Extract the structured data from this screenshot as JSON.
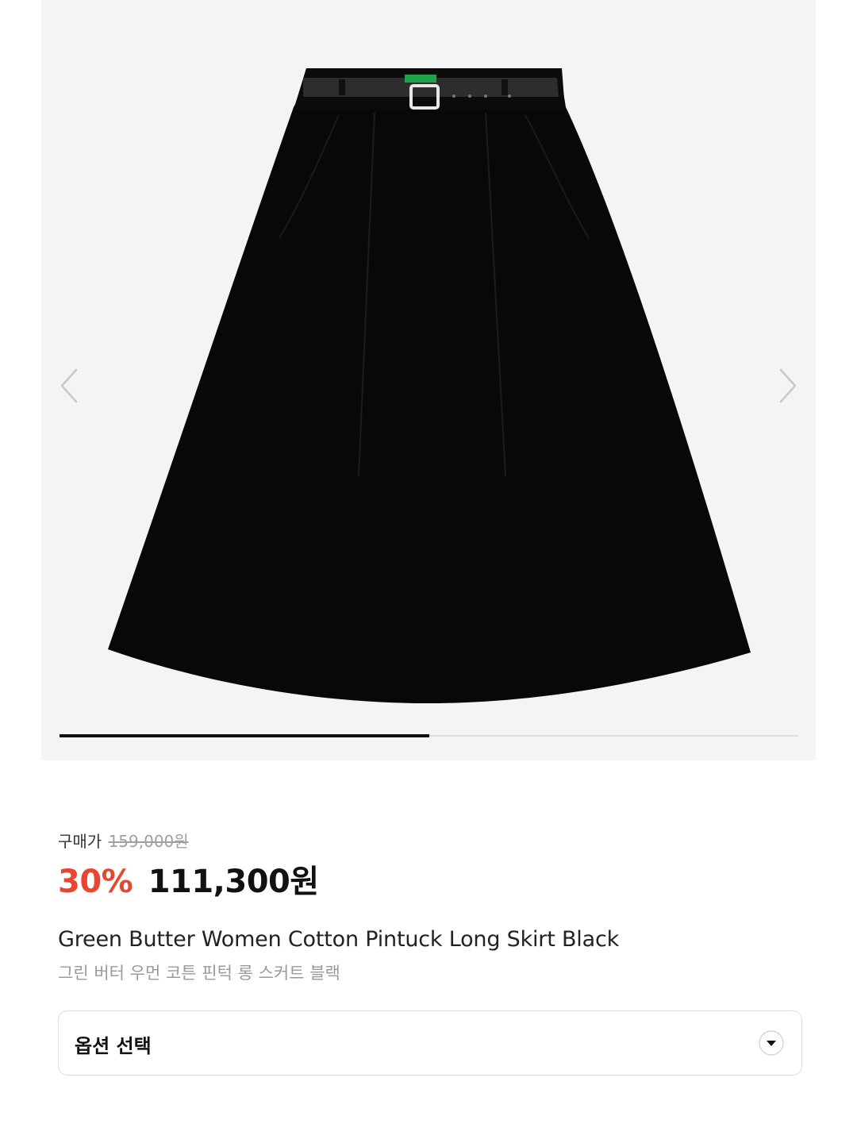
{
  "gallery": {
    "image_alt": "Black A-line long skirt with black leather belt",
    "current_slide_fraction": 0.5,
    "prev_icon": "chevron-left-icon",
    "next_icon": "chevron-right-icon"
  },
  "price": {
    "label": "구매가",
    "original": "159,000원",
    "discount": "30%",
    "sale": "111,300원"
  },
  "product": {
    "name_en": "Green Butter Women Cotton Pintuck Long Skirt Black",
    "name_ko": "그린 버터 우먼 코튼 핀턱 롱 스커트 블랙"
  },
  "option": {
    "label": "옵션 선택",
    "icon": "caret-down-circle-icon"
  },
  "colors": {
    "discount": "#e8462f",
    "gallery_bg": "#f4f4f4",
    "progress_active": "#111111",
    "progress_track": "#dcdcdc"
  }
}
